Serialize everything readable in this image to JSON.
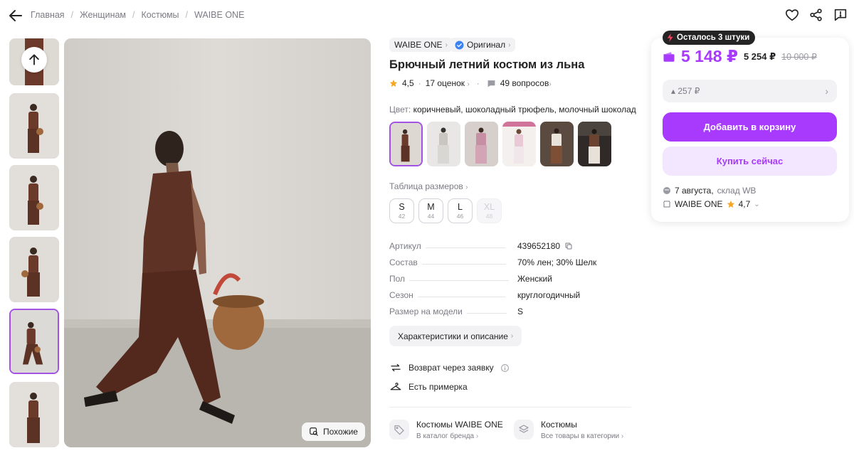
{
  "breadcrumbs": [
    "Главная",
    "Женщинам",
    "Костюмы",
    "WAIBE ONE"
  ],
  "icons": {
    "back": "arrow-left-icon",
    "favorite": "heart-icon",
    "share": "share-icon",
    "report": "report-icon",
    "scroll_up": "arrow-up-icon",
    "similar": "visual-search-icon",
    "star": "star-icon",
    "questions": "questions-icon",
    "verified": "verified-badge-icon",
    "copy": "copy-icon",
    "return": "return-arrows-icon",
    "fitting": "hanger-icon",
    "brand_tag": "tag-icon",
    "category": "stack-icon",
    "wallet": "wallet-icon",
    "lightning": "lightning-icon",
    "delivery": "box-icon",
    "seller": "shop-icon",
    "info": "info-icon"
  },
  "colors": {
    "accent": "#a73afd",
    "accent_light": "#f3e6ff",
    "active_border": "#a452e6",
    "star": "#f5a623",
    "badge_bg": "#242424",
    "lightning": "#ff3b5c"
  },
  "gallery": {
    "similar_label": "Похожие"
  },
  "product": {
    "brand": "WAIBE ONE",
    "original_label": "Оригинал",
    "title": "Брючный летний костюм из льна",
    "rating": "4,5",
    "reviews": "17 оценок",
    "questions": "49 вопросов",
    "color_label": "Цвет:",
    "color_value": "коричневый, шоколадный трюфель, молочный шоколад",
    "size_table_label": "Таблица размеров",
    "sizes": [
      {
        "label": "S",
        "ru": "42",
        "available": true
      },
      {
        "label": "M",
        "ru": "44",
        "available": true
      },
      {
        "label": "L",
        "ru": "46",
        "available": true
      },
      {
        "label": "XL",
        "ru": "48",
        "available": false
      }
    ],
    "specs": [
      {
        "key": "Артикул",
        "value": "439652180"
      },
      {
        "key": "Состав",
        "value": "70% лен; 30% Шелк"
      },
      {
        "key": "Пол",
        "value": "Женский"
      },
      {
        "key": "Сезон",
        "value": "круглогодичный"
      },
      {
        "key": "Размер на модели",
        "value": "S"
      }
    ],
    "characteristics_label": "Характеристики и описание",
    "features": [
      "Возврат через заявку",
      "Есть примерка"
    ],
    "links": [
      {
        "title": "Костюмы WAIBE ONE",
        "subtitle": "В каталог бренда"
      },
      {
        "title": "Костюмы",
        "subtitle": "Все товары в категории"
      }
    ]
  },
  "buy_panel": {
    "stock_badge": "Осталось 3 штуки",
    "price": "5 148 ₽",
    "price_secondary": "5 254 ₽",
    "price_old": "10 000 ₽",
    "delta": "▴ 257 ₽",
    "add_to_cart": "Добавить в корзину",
    "buy_now": "Купить сейчас",
    "delivery_date": "7 августа,",
    "delivery_source": "склад WB",
    "seller": "WAIBE ONE",
    "seller_rating": "4,7"
  }
}
